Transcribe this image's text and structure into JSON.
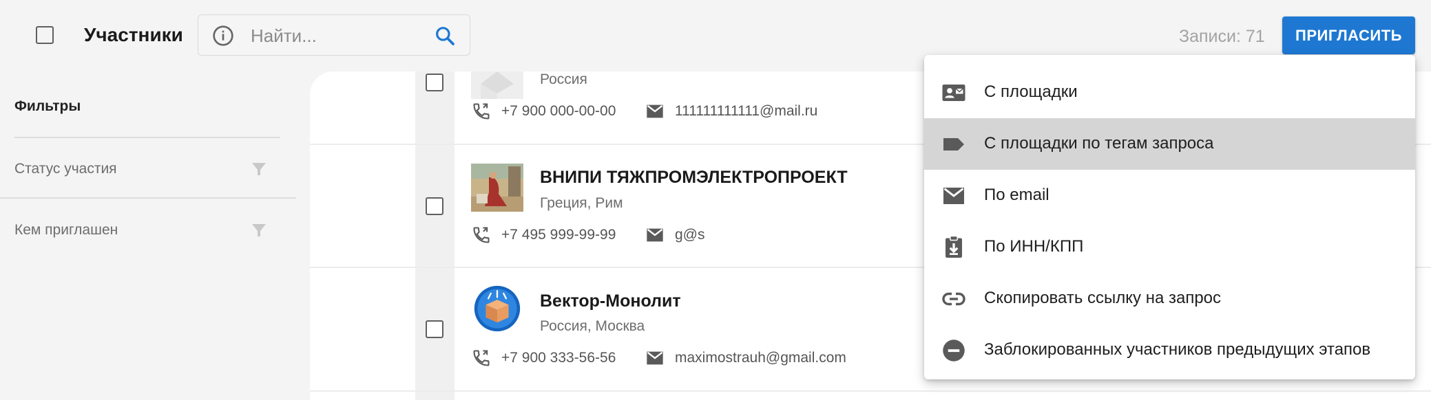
{
  "header": {
    "title": "Участники",
    "search_placeholder": "Найти...",
    "records_label": "Записи: 71",
    "invite_label": "ПРИГЛАСИТЬ"
  },
  "sidebar": {
    "title": "Фильтры",
    "filters": [
      {
        "label": "Статус участия"
      },
      {
        "label": "Кем приглашен"
      }
    ]
  },
  "participants": [
    {
      "name": "",
      "location": "Россия",
      "phone": "+7 900 000-00-00",
      "email": "111111111111@mail.ru",
      "avatar": "placeholder-logo"
    },
    {
      "name": "ВНИПИ ТЯЖПРОМЭЛЕКТРОПРОЕКТ",
      "location": "Греция, Рим",
      "phone": "+7 495 999-99-99",
      "email": "g@s",
      "avatar": "painting-thumbnail"
    },
    {
      "name": "Вектор-Монолит",
      "location": "Россия, Москва",
      "phone": "+7 900 333-56-56",
      "email": "maximostrauh@gmail.com",
      "avatar": "box-logo"
    }
  ],
  "invite_menu": {
    "items": [
      {
        "label": "С площадки",
        "icon": "contact-card-icon"
      },
      {
        "label": "С площадки по тегам запроса",
        "icon": "label-tag-icon",
        "highlighted": true
      },
      {
        "label": "По email",
        "icon": "email-icon"
      },
      {
        "label": "По ИНН/КПП",
        "icon": "clipboard-download-icon"
      },
      {
        "label": "Скопировать ссылку на запрос",
        "icon": "link-icon"
      },
      {
        "label": "Заблокированных участников предыдущих этапов",
        "icon": "block-icon"
      }
    ]
  },
  "colors": {
    "accent": "#1e78d2",
    "background": "#f4f4f4",
    "menu_highlight": "#d5d5d5"
  }
}
